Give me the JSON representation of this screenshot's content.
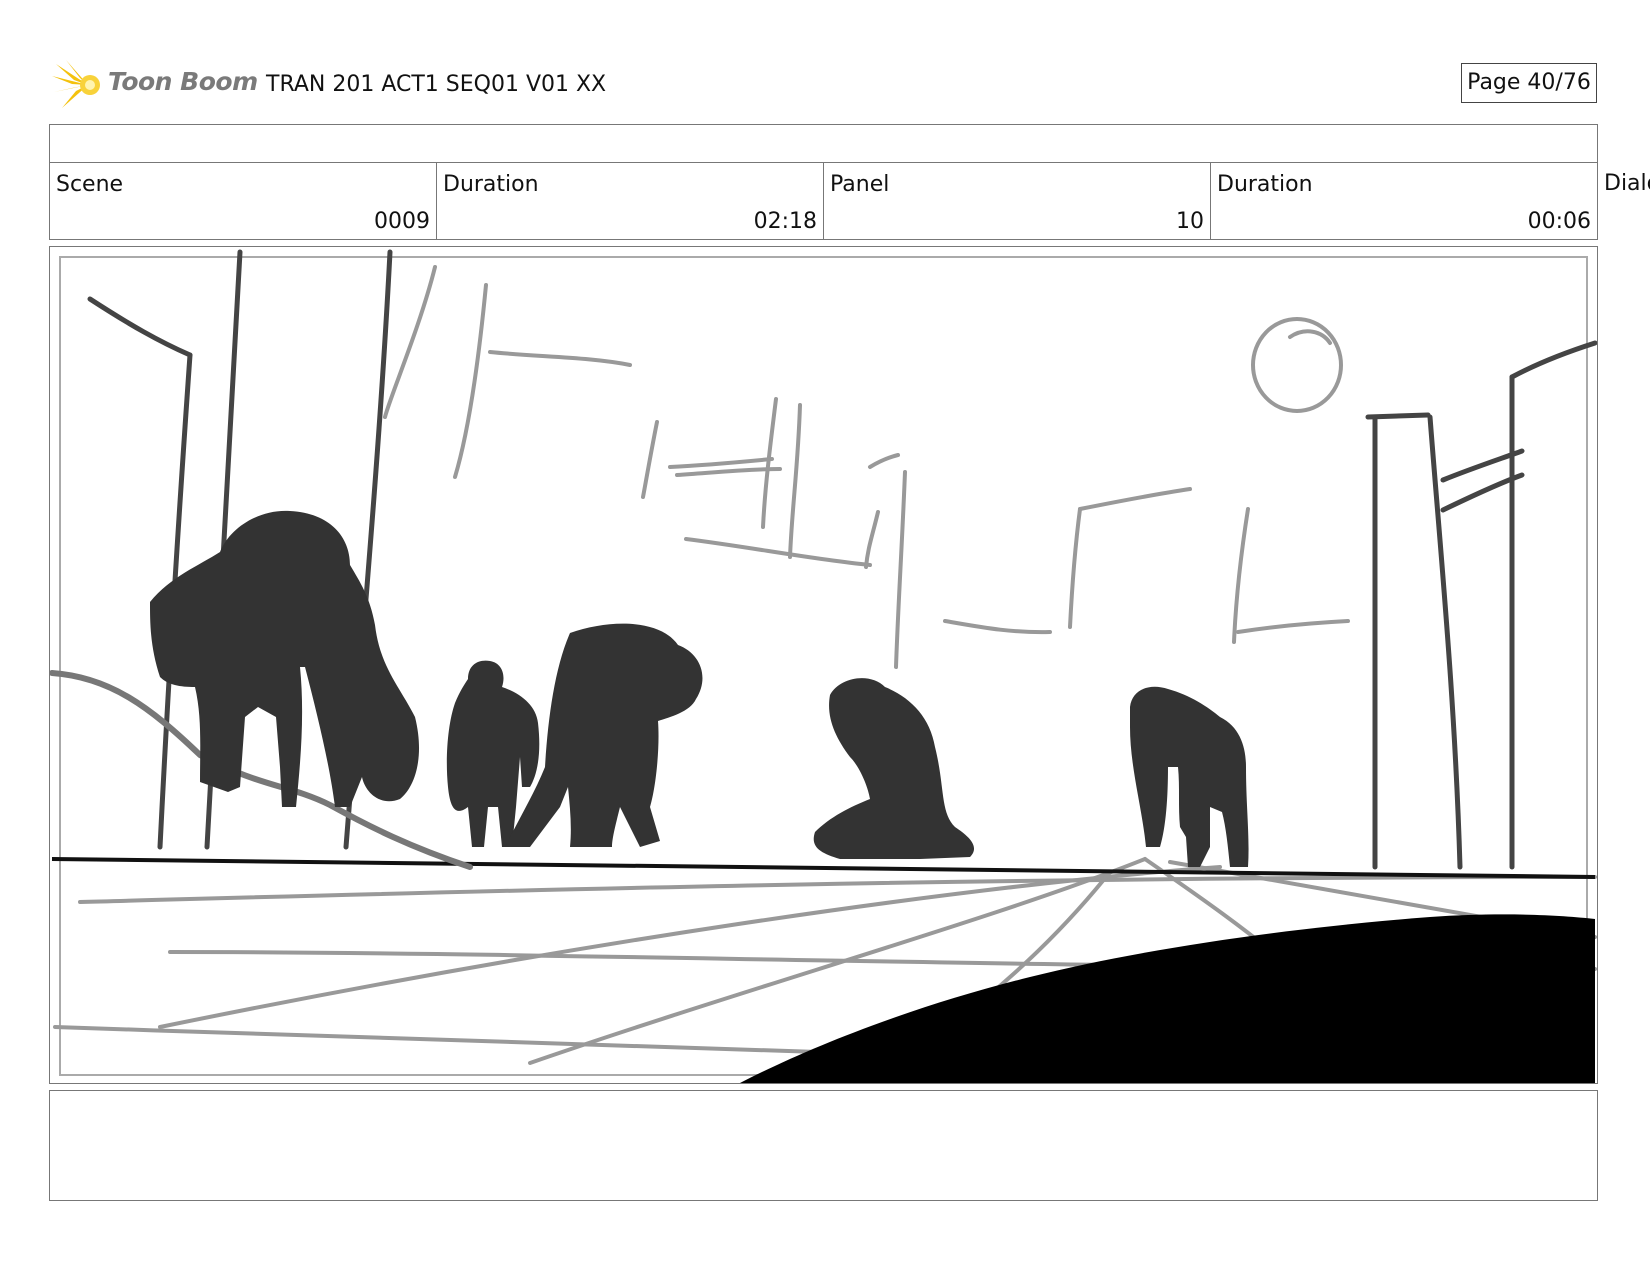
{
  "header": {
    "logo_text": "Toon Boom",
    "doc_title": "TRAN 201 ACT1 SEQ01 V01 XX",
    "page_label": "Page 40/76"
  },
  "info": {
    "scene_label": "Scene",
    "scene_value": "0009",
    "scene_duration_label": "Duration",
    "scene_duration_value": "02:18",
    "panel_label": "Panel",
    "panel_value": "10",
    "panel_duration_label": "Duration",
    "panel_duration_value": "00:06",
    "dialog_label": "Dialo"
  },
  "colors": {
    "logo_star": "#f4c20d",
    "silhouette": "#333333",
    "sketch_gray": "#999999",
    "ink": "#000000"
  }
}
